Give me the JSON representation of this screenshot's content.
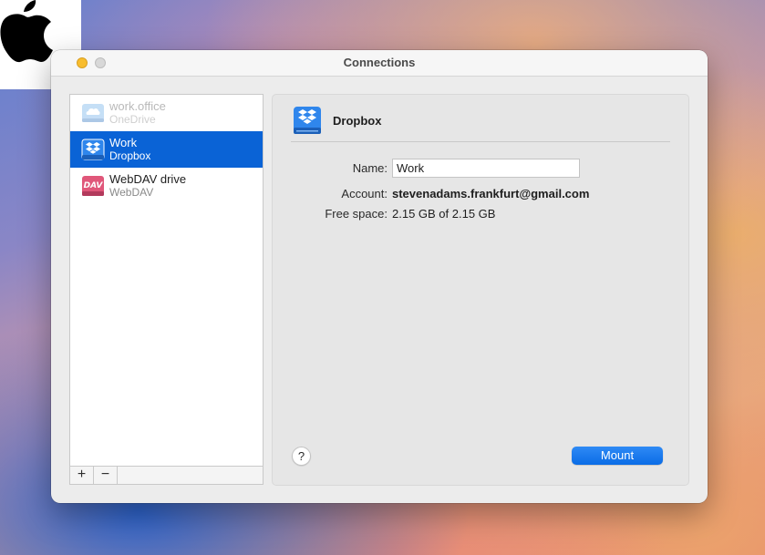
{
  "window": {
    "title": "Connections"
  },
  "sidebar": {
    "items": [
      {
        "name": "work.office",
        "service": "OneDrive",
        "icon": "onedrive-cloud-icon",
        "state": "disabled"
      },
      {
        "name": "Work",
        "service": "Dropbox",
        "icon": "dropbox-drive-icon",
        "state": "selected"
      },
      {
        "name": "WebDAV drive",
        "service": "WebDAV",
        "icon": "webdav-drive-icon",
        "state": "normal"
      }
    ],
    "add_label": "+",
    "remove_label": "−"
  },
  "detail": {
    "title": "Dropbox",
    "icon": "dropbox-drive-icon",
    "name_label": "Name:",
    "name_value": "Work",
    "account_label": "Account:",
    "account_value": "stevenadams.frankfurt@gmail.com",
    "free_space_label": "Free space:",
    "free_space_value": "2.15 GB of 2.15 GB",
    "help_label": "?",
    "mount_label": "Mount"
  },
  "colors": {
    "accent": "#0a63d6",
    "button": "#1677ee",
    "dropbox_blue": "#1f74e0",
    "webdav_pink": "#e0577a"
  }
}
